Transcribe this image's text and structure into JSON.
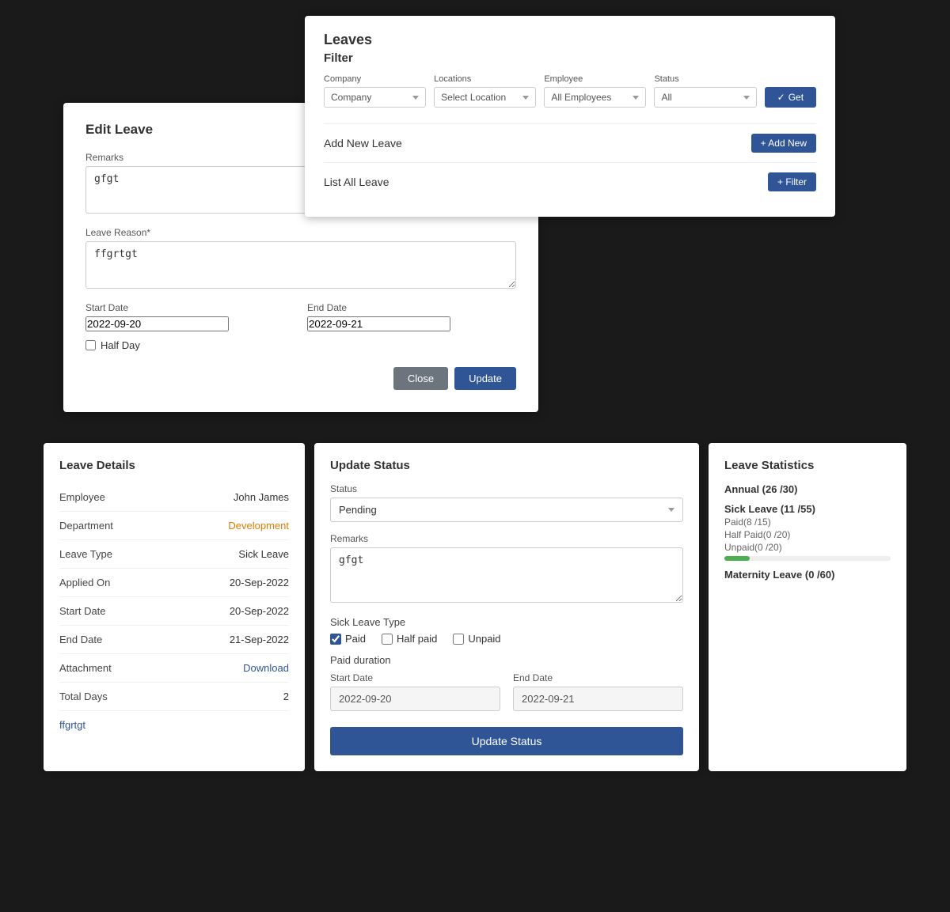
{
  "leaves_panel": {
    "title": "Leaves",
    "filter_title": "Filter",
    "company_label": "Company",
    "company_placeholder": "Company",
    "locations_label": "Locations",
    "locations_placeholder": "Select Location",
    "employee_label": "Employee",
    "employee_value": "All Employees",
    "status_label": "Status",
    "status_value": "All",
    "get_button": "Get",
    "add_new_label": "Add New Leave",
    "add_new_button": "+ Add New",
    "list_all_label": "List All Leave",
    "filter_button": "+ Filter"
  },
  "edit_leave": {
    "title": "Edit Leave",
    "remarks_label": "Remarks",
    "remarks_value": "gfgt",
    "reason_label": "Leave Reason*",
    "reason_value": "ffgrtgt",
    "start_date_label": "Start Date",
    "start_date_value": "2022-09-20",
    "end_date_label": "End Date",
    "end_date_value": "2022-09-21",
    "half_day_label": "Half Day",
    "close_button": "Close",
    "update_button": "Update"
  },
  "leave_details": {
    "title": "Leave Details",
    "employee_label": "Employee",
    "employee_value": "John James",
    "department_label": "Department",
    "department_value": "Development",
    "leave_type_label": "Leave Type",
    "leave_type_value": "Sick Leave",
    "applied_on_label": "Applied On",
    "applied_on_value": "20-Sep-2022",
    "start_date_label": "Start Date",
    "start_date_value": "20-Sep-2022",
    "end_date_label": "End Date",
    "end_date_value": "21-Sep-2022",
    "attachment_label": "Attachment",
    "attachment_value": "Download",
    "total_days_label": "Total Days",
    "total_days_value": "2",
    "remark": "ffgrtgt"
  },
  "update_status": {
    "title": "Update Status",
    "status_label": "Status",
    "status_value": "Pending",
    "remarks_label": "Remarks",
    "remarks_value": "gfgt",
    "sick_leave_type_label": "Sick Leave Type",
    "paid_label": "Paid",
    "half_paid_label": "Half paid",
    "unpaid_label": "Unpaid",
    "paid_duration_label": "Paid duration",
    "start_date_label": "Start Date",
    "start_date_value": "2022-09-20",
    "end_date_label": "End Date",
    "end_date_value": "2022-09-21",
    "update_button": "Update Status"
  },
  "leave_stats": {
    "title": "Leave Statistics",
    "annual_label": "Annual (26 /30)",
    "sick_leave_label": "Sick Leave (11 /55)",
    "paid_label": "Paid(8 /15)",
    "half_paid_label": "Half Paid(0 /20)",
    "unpaid_label": "Unpaid(0 /20)",
    "bar_percent": 15,
    "maternity_label": "Maternity Leave (0 /60)"
  }
}
